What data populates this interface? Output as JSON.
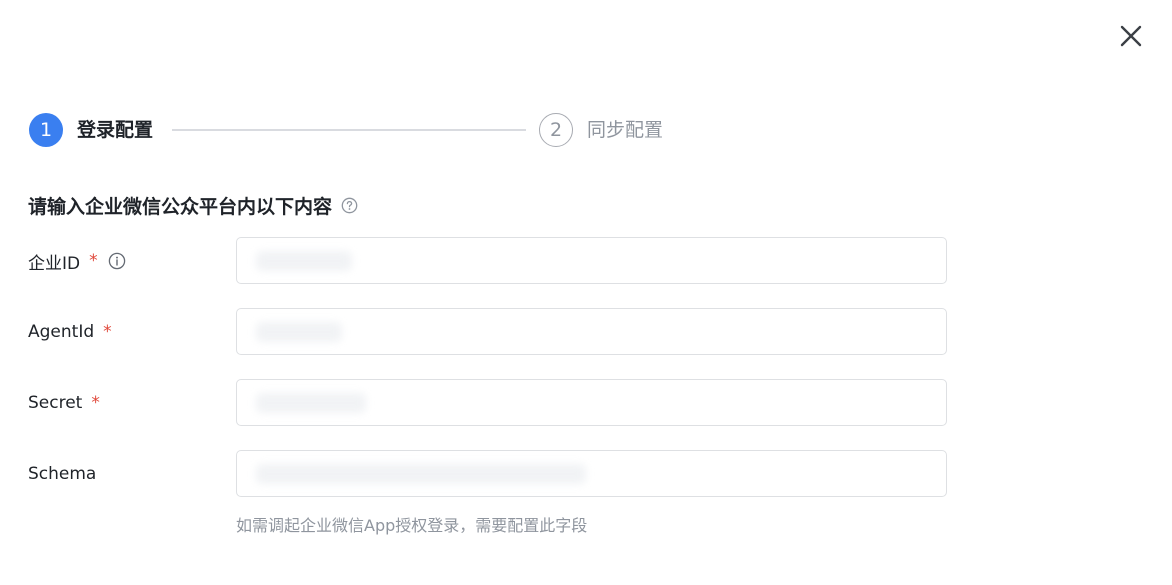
{
  "dialog": {
    "close_icon": "close-icon"
  },
  "steps": [
    {
      "number": "1",
      "label": "登录配置",
      "state": "active"
    },
    {
      "number": "2",
      "label": "同步配置",
      "state": "inactive"
    }
  ],
  "section": {
    "title": "请输入企业微信公众平台内以下内容",
    "help_icon": "question-circle-icon"
  },
  "fields": [
    {
      "label": "企业ID",
      "required": "*",
      "info_icon": "info-circle-icon",
      "value": "",
      "placeholder": ""
    },
    {
      "label": "AgentId",
      "required": "*",
      "value": "",
      "placeholder": ""
    },
    {
      "label": "Secret",
      "required": "*",
      "value": "",
      "placeholder": ""
    },
    {
      "label": "Schema",
      "value": "",
      "placeholder": ""
    }
  ],
  "schema_hint": "如需调起企业微信App授权登录，需要配置此字段",
  "colors": {
    "primary": "#3a7ff0",
    "required": "#e0483b",
    "muted": "#8f959e",
    "border": "#dee0e3"
  }
}
